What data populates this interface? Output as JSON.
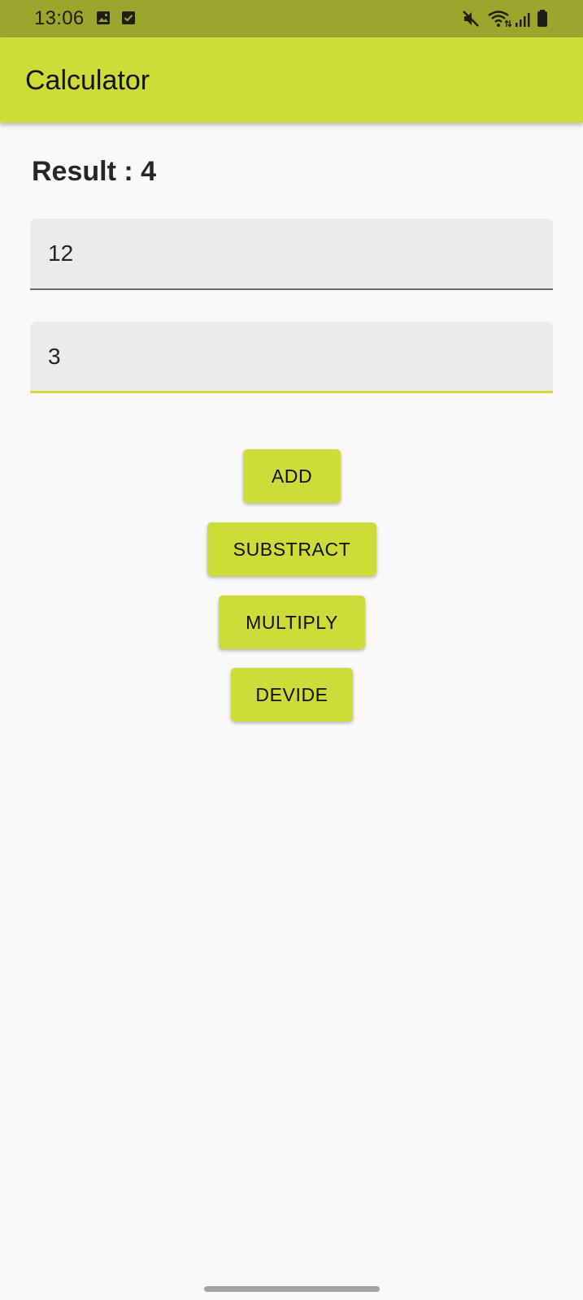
{
  "status_bar": {
    "time": "13:06",
    "left_icons": [
      "image-icon",
      "checkbox-icon"
    ],
    "right_icons": [
      "mute-icon",
      "wifi-icon",
      "signal-icon",
      "battery-icon"
    ]
  },
  "app_bar": {
    "title": "Calculator"
  },
  "result": {
    "text": "Result : 4"
  },
  "inputs": {
    "first_value": "12",
    "second_value": "3"
  },
  "buttons": {
    "add": "ADD",
    "subtract": "SUBSTRACT",
    "multiply": "MULTIPLY",
    "divide": "DEVIDE"
  },
  "colors": {
    "accent": "#cddc39",
    "status_bar": "#9ca52c",
    "background": "#f9f9f9",
    "input_fill": "#ebebea"
  }
}
